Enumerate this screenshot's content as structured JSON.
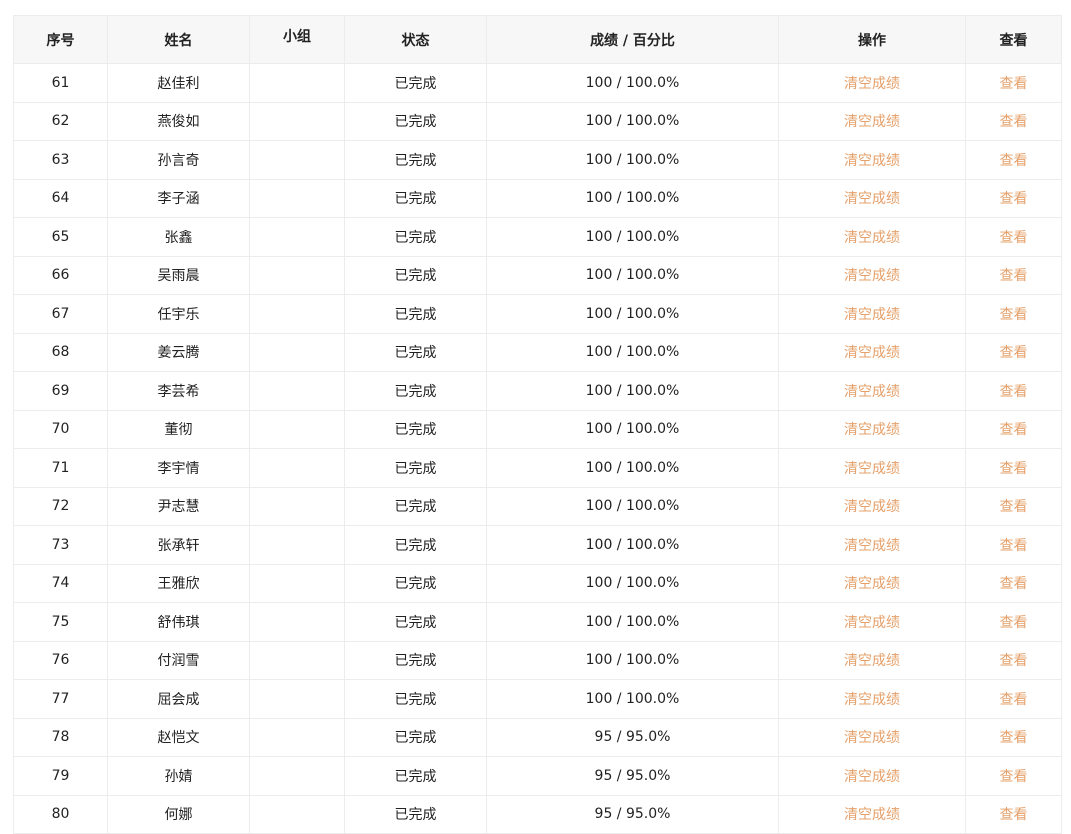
{
  "table": {
    "headers": {
      "index": "序号",
      "name": "姓名",
      "group": "小组",
      "status": "状态",
      "score": "成绩 / 百分比",
      "action": "操作",
      "view": "查看"
    },
    "rows": [
      {
        "index": "61",
        "name": "赵佳利",
        "group": "",
        "status": "已完成",
        "score": "100 / 100.0%",
        "action": "清空成绩",
        "view": "查看"
      },
      {
        "index": "62",
        "name": "燕俊如",
        "group": "",
        "status": "已完成",
        "score": "100 / 100.0%",
        "action": "清空成绩",
        "view": "查看"
      },
      {
        "index": "63",
        "name": "孙言奇",
        "group": "",
        "status": "已完成",
        "score": "100 / 100.0%",
        "action": "清空成绩",
        "view": "查看"
      },
      {
        "index": "64",
        "name": "李子涵",
        "group": "",
        "status": "已完成",
        "score": "100 / 100.0%",
        "action": "清空成绩",
        "view": "查看"
      },
      {
        "index": "65",
        "name": "张鑫",
        "group": "",
        "status": "已完成",
        "score": "100 / 100.0%",
        "action": "清空成绩",
        "view": "查看"
      },
      {
        "index": "66",
        "name": "吴雨晨",
        "group": "",
        "status": "已完成",
        "score": "100 / 100.0%",
        "action": "清空成绩",
        "view": "查看"
      },
      {
        "index": "67",
        "name": "任宇乐",
        "group": "",
        "status": "已完成",
        "score": "100 / 100.0%",
        "action": "清空成绩",
        "view": "查看"
      },
      {
        "index": "68",
        "name": "姜云腾",
        "group": "",
        "status": "已完成",
        "score": "100 / 100.0%",
        "action": "清空成绩",
        "view": "查看"
      },
      {
        "index": "69",
        "name": "李芸希",
        "group": "",
        "status": "已完成",
        "score": "100 / 100.0%",
        "action": "清空成绩",
        "view": "查看"
      },
      {
        "index": "70",
        "name": "董彻",
        "group": "",
        "status": "已完成",
        "score": "100 / 100.0%",
        "action": "清空成绩",
        "view": "查看"
      },
      {
        "index": "71",
        "name": "李宇情",
        "group": "",
        "status": "已完成",
        "score": "100 / 100.0%",
        "action": "清空成绩",
        "view": "查看"
      },
      {
        "index": "72",
        "name": "尹志慧",
        "group": "",
        "status": "已完成",
        "score": "100 / 100.0%",
        "action": "清空成绩",
        "view": "查看"
      },
      {
        "index": "73",
        "name": "张承轩",
        "group": "",
        "status": "已完成",
        "score": "100 / 100.0%",
        "action": "清空成绩",
        "view": "查看"
      },
      {
        "index": "74",
        "name": "王雅欣",
        "group": "",
        "status": "已完成",
        "score": "100 / 100.0%",
        "action": "清空成绩",
        "view": "查看"
      },
      {
        "index": "75",
        "name": "舒伟琪",
        "group": "",
        "status": "已完成",
        "score": "100 / 100.0%",
        "action": "清空成绩",
        "view": "查看"
      },
      {
        "index": "76",
        "name": "付润雪",
        "group": "",
        "status": "已完成",
        "score": "100 / 100.0%",
        "action": "清空成绩",
        "view": "查看"
      },
      {
        "index": "77",
        "name": "屈会成",
        "group": "",
        "status": "已完成",
        "score": "100 / 100.0%",
        "action": "清空成绩",
        "view": "查看"
      },
      {
        "index": "78",
        "name": "赵恺文",
        "group": "",
        "status": "已完成",
        "score": "95 / 95.0%",
        "action": "清空成绩",
        "view": "查看"
      },
      {
        "index": "79",
        "name": "孙婧",
        "group": "",
        "status": "已完成",
        "score": "95 / 95.0%",
        "action": "清空成绩",
        "view": "查看"
      },
      {
        "index": "80",
        "name": "何娜",
        "group": "",
        "status": "已完成",
        "score": "95 / 95.0%",
        "action": "清空成绩",
        "view": "查看"
      }
    ]
  },
  "colors": {
    "action_link": "#e6a06a",
    "header_bg": "#f7f7f7",
    "border": "#ececec"
  }
}
